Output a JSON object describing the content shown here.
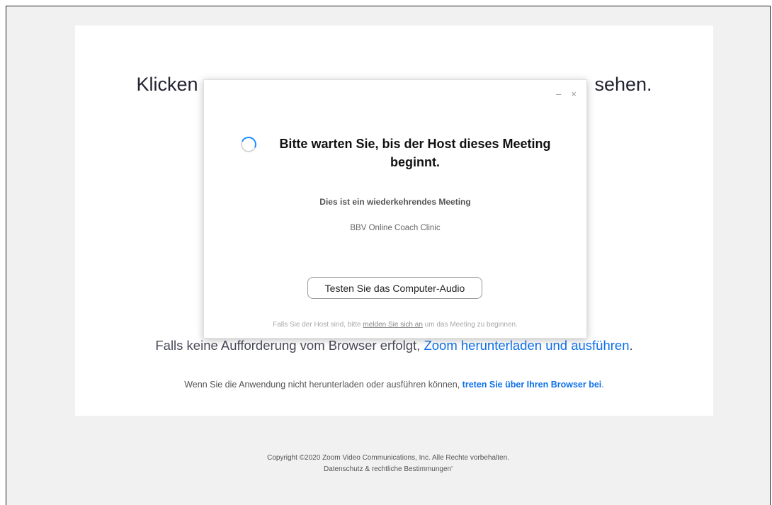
{
  "launch": {
    "heading_left": "Klicken",
    "heading_right": "sehen.",
    "fallback_text": "Falls keine Aufforderung vom Browser erfolgt,",
    "fallback_link": "Zoom herunterladen und ausführen",
    "fallback_end": ".",
    "browser_text": "Wenn Sie die Anwendung nicht herunterladen oder ausführen können,",
    "browser_link": "treten Sie über Ihren Browser bei",
    "browser_end": "."
  },
  "dialog": {
    "minimize_label": "–",
    "close_label": "×",
    "wait_message": "Bitte warten Sie, bis der Host dieses Meeting beginnt.",
    "recurring_label": "Dies ist ein wiederkehrendes Meeting",
    "meeting_name": "BBV Online Coach Clinic",
    "audio_button": "Testen Sie das Computer-Audio",
    "host_note_prefix": "Falls Sie der Host sind, bitte",
    "host_note_link": "melden Sie sich an",
    "host_note_suffix": "um das Meeting zu beginnen."
  },
  "footer": {
    "copyright": "Copyright ©2020 Zoom Video Communications, Inc. Alle Rechte vorbehalten.",
    "privacy_link": "Datenschutz & rechtliche Bestimmungen'"
  },
  "colors": {
    "link_blue": "#0e71eb",
    "spinner_blue": "#1a8cff",
    "background": "#f1f1f1"
  },
  "icons": {
    "spinner": "loading-spinner-icon",
    "minimize": "minimize-icon",
    "close": "close-icon"
  }
}
